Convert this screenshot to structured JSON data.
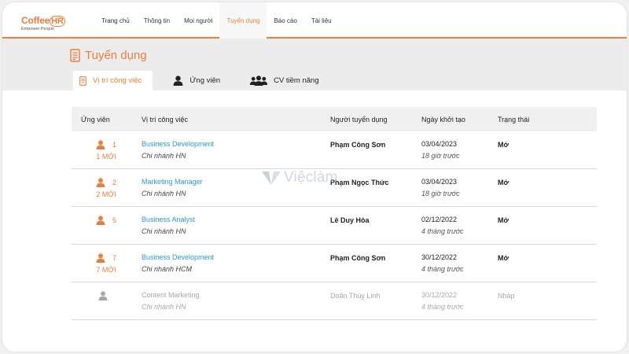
{
  "brand": {
    "name_part1": "Coffee",
    "name_part2": "HR",
    "tagline": "Empower People",
    "accent": "#ee7d3b"
  },
  "nav": {
    "items": [
      {
        "label": "Trang chủ"
      },
      {
        "label": "Thông tin"
      },
      {
        "label": "Mọi người"
      },
      {
        "label": "Tuyển dụng",
        "active": true
      },
      {
        "label": "Báo cáo"
      },
      {
        "label": "Tài liệu"
      }
    ]
  },
  "page": {
    "title": "Tuyển dụng",
    "icon": "document-icon"
  },
  "tabs": [
    {
      "label": "Vị trí công việc",
      "icon": "document-icon",
      "active": true
    },
    {
      "label": "Ứng viên",
      "icon": "person-icon"
    },
    {
      "label": "CV tiềm năng",
      "icon": "group-icon"
    }
  ],
  "table": {
    "headers": {
      "candidates": "Ứng viên",
      "position": "Vị trí công việc",
      "recruiter": "Người tuyển dụng",
      "created": "Ngày khởi tạo",
      "status": "Trạng thái"
    },
    "rows": [
      {
        "count": "1",
        "new": "1 MỚI",
        "title": "Business Development",
        "branch": "Chi nhánh HN",
        "recruiter": "Phạm Công Sơn",
        "date": "03/04/2023",
        "ago": "18 giờ trước",
        "status": "Mở"
      },
      {
        "count": "2",
        "new": "2 MỚI",
        "title": "Marketing Manager",
        "branch": "Chi nhánh HN",
        "recruiter": "Phạm Ngọc Thức",
        "date": "03/04/2023",
        "ago": "18 giờ trước",
        "status": "Mở"
      },
      {
        "count": "5",
        "new": "",
        "title": "Business Analyst",
        "branch": "Chi nhánh HN",
        "recruiter": "Lê Duy Hòa",
        "date": "02/12/2022",
        "ago": "4 tháng trước",
        "status": "Mở"
      },
      {
        "count": "7",
        "new": "7 MỚI",
        "title": "Business Development",
        "branch": "Chi nhánh HCM",
        "recruiter": "Phạm Công Sơn",
        "date": "30/12/2022",
        "ago": "4 tháng trước",
        "status": "Mở"
      },
      {
        "count": "",
        "new": "",
        "title": "Content Marketing",
        "branch": "Chi nhánh HN",
        "recruiter": "Doãn Thùy Linh",
        "date": "30/12/2022",
        "ago": "4 tháng trước",
        "status": "Nháp"
      }
    ]
  },
  "watermark": {
    "text": "Việclàm"
  }
}
